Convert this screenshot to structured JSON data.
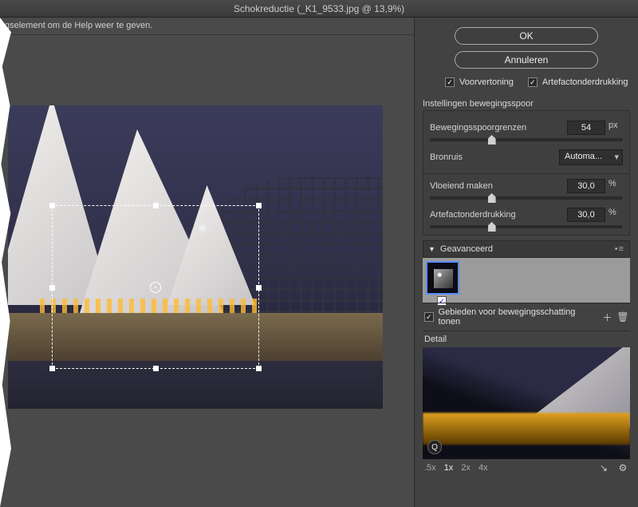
{
  "window": {
    "title": "Schokreductie (_K1_9533.jpg @ 13,9%)"
  },
  "top_message": "gselement om de Help weer te geven.",
  "buttons": {
    "ok": "OK",
    "cancel": "Annuleren"
  },
  "checkboxes": {
    "preview": {
      "label": "Voorvertoning",
      "checked": true
    },
    "artifact": {
      "label": "Artefactonderdrukking",
      "checked": true
    },
    "show_regions": {
      "label": "Gebieden voor bewegingsschatting tonen",
      "checked": true
    },
    "thumb": {
      "checked": true
    }
  },
  "sections": {
    "blur_trace": "Instellingen bewegingsspoor",
    "advanced": "Geavanceerd",
    "detail": "Detail"
  },
  "sliders": {
    "bounds": {
      "label": "Bewegingsspoorgrenzen",
      "value": "54",
      "unit": "px",
      "pos": 30
    },
    "source_noise": {
      "label": "Bronruis",
      "value": "Automa..."
    },
    "smoothing": {
      "label": "Vloeiend maken",
      "value": "30,0",
      "unit": "%",
      "pos": 30
    },
    "artifact_supp": {
      "label": "Artefactonderdrukking",
      "value": "30,0",
      "unit": "%",
      "pos": 30
    }
  },
  "zoom": {
    "levels": [
      ".5x",
      "1x",
      "2x",
      "4x"
    ],
    "active": "1x"
  },
  "icons": {
    "add": "⊕",
    "trash": "🗑",
    "gear": "⚙",
    "undock": "↘",
    "q": "Q"
  }
}
